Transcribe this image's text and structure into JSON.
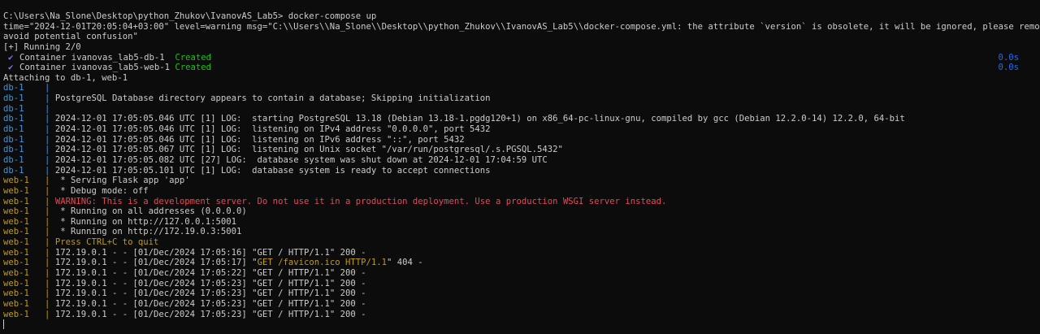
{
  "command": "C:\\Users\\Na_Slone\\Desktop\\python_Zhukov\\IvanovAS_Lab5> docker-compose up",
  "warning_lines": [
    "time=\"2024-12-01T20:05:04+03:00\" level=warning msg=\"C:\\\\Users\\\\Na_Slone\\\\Desktop\\\\python_Zhukov\\\\IvanovAS_Lab5\\\\docker-compose.yml: the attribute `version` is obsolete, it will be ignored, please remove it to",
    "avoid potential confusion\""
  ],
  "running": "[+] Running 2/0",
  "containers": [
    {
      "name": "Container ivanovas_lab5-db-1",
      "status": "Created",
      "time": "0.0s"
    },
    {
      "name": "Container ivanovas_lab5-web-1",
      "status": "Created",
      "time": "0.0s"
    }
  ],
  "attaching": "Attaching to db-1, web-1",
  "db_logs": [
    "",
    "PostgreSQL Database directory appears to contain a database; Skipping initialization",
    "",
    "2024-12-01 17:05:05.046 UTC [1] LOG:  starting PostgreSQL 13.18 (Debian 13.18-1.pgdg120+1) on x86_64-pc-linux-gnu, compiled by gcc (Debian 12.2.0-14) 12.2.0, 64-bit",
    "2024-12-01 17:05:05.046 UTC [1] LOG:  listening on IPv4 address \"0.0.0.0\", port 5432",
    "2024-12-01 17:05:05.046 UTC [1] LOG:  listening on IPv6 address \"::\", port 5432",
    "2024-12-01 17:05:05.067 UTC [1] LOG:  listening on Unix socket \"/var/run/postgresql/.s.PGSQL.5432\"",
    "2024-12-01 17:05:05.082 UTC [27] LOG:  database system was shut down at 2024-12-01 17:04:59 UTC",
    "2024-12-01 17:05:05.101 UTC [1] LOG:  database system is ready to accept connections"
  ],
  "web_logs": [
    {
      "text": " * Serving Flask app 'app'"
    },
    {
      "text": " * Debug mode: off"
    },
    {
      "text": "WARNING: This is a development server. Do not use it in a production deployment. Use a production WSGI server instead.",
      "style": "warn"
    },
    {
      "text": " * Running on all addresses (0.0.0.0)"
    },
    {
      "text": " * Running on http://127.0.0.1:5001"
    },
    {
      "text": " * Running on http://172.19.0.3:5001"
    },
    {
      "text": "Press CTRL+C to quit",
      "style": "yellow"
    },
    {
      "text": "172.19.0.1 - - [01/Dec/2024 17:05:16] \"GET / HTTP/1.1\" 200 -"
    },
    {
      "pre": "172.19.0.1 - - [01/Dec/2024 17:05:17] \"",
      "hl": "GET /favicon.ico HTTP/1.1",
      "post": "\" 404 -"
    },
    {
      "text": "172.19.0.1 - - [01/Dec/2024 17:05:22] \"GET / HTTP/1.1\" 200 -"
    },
    {
      "text": "172.19.0.1 - - [01/Dec/2024 17:05:23] \"GET / HTTP/1.1\" 200 -"
    },
    {
      "text": "172.19.0.1 - - [01/Dec/2024 17:05:23] \"GET / HTTP/1.1\" 200 -"
    },
    {
      "text": "172.19.0.1 - - [01/Dec/2024 17:05:23] \"GET / HTTP/1.1\" 200 -"
    },
    {
      "text": "172.19.0.1 - - [01/Dec/2024 17:05:23] \"GET / HTTP/1.1\" 200 -"
    }
  ],
  "labels": {
    "db": "db-1",
    "web": "web-1",
    "separator": "|"
  },
  "colors": {
    "background": "#0c0c0c",
    "text": "#cccccc",
    "db_prefix": "#3a96dd",
    "web_prefix": "#c19c00",
    "created": "#13c013",
    "timing": "#1a6cf0",
    "warning": "#e74856",
    "check": "#8a6dff"
  },
  "icons": {
    "check": "check-icon"
  }
}
